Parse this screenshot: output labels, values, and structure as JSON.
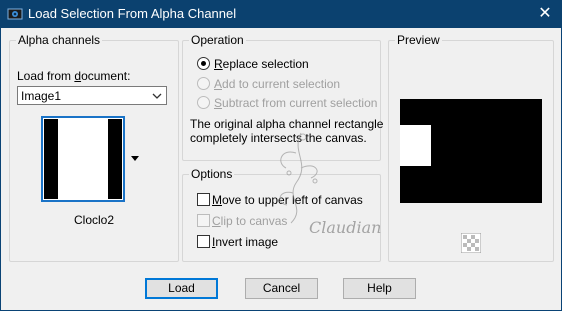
{
  "window": {
    "title": "Load Selection From Alpha Channel",
    "close_glyph": "✕"
  },
  "alpha_channels": {
    "group_label": "Alpha channels",
    "load_from_label_pre": "Load from ",
    "load_from_label_ul": "d",
    "load_from_label_post": "ocument:",
    "document_value": "Image1",
    "channel_name": "Cloclo2"
  },
  "operation": {
    "group_label": "Operation",
    "options": [
      {
        "ul": "R",
        "rest": "eplace selection",
        "selected": true,
        "enabled": true
      },
      {
        "ul": "A",
        "rest": "dd to current selection",
        "selected": false,
        "enabled": false
      },
      {
        "ul": "S",
        "rest": "ubtract from current selection",
        "selected": false,
        "enabled": false
      }
    ],
    "message_line1": "The original alpha channel rectangle",
    "message_line2": "completely intersects the canvas."
  },
  "options": {
    "group_label": "Options",
    "items": [
      {
        "ul": "M",
        "rest": "ove to upper left of canvas",
        "checked": false,
        "enabled": true
      },
      {
        "ul": "C",
        "rest": "lip to canvas",
        "checked": false,
        "enabled": false
      },
      {
        "ul": "I",
        "rest": "nvert image",
        "checked": false,
        "enabled": true
      }
    ]
  },
  "preview": {
    "group_label": "Preview"
  },
  "buttons": {
    "load": "Load",
    "cancel": "Cancel",
    "help": "Help"
  },
  "watermark": {
    "text": "Claudiane"
  },
  "colors": {
    "titlebar": "#0b416f",
    "dialog_bg": "#f0f0f0",
    "accent": "#0078d7"
  }
}
